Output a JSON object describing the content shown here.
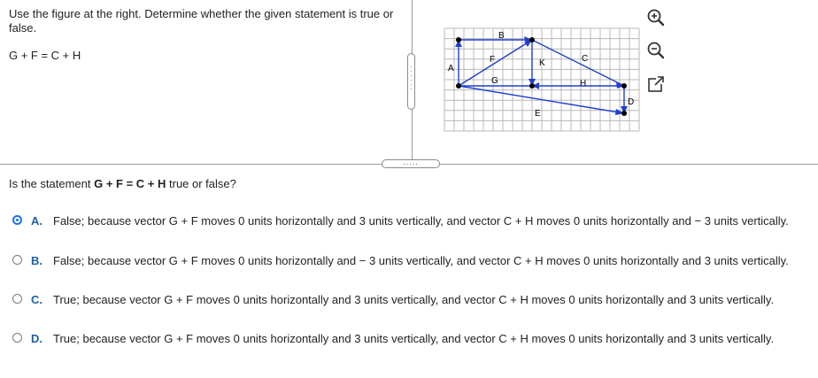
{
  "question_prompt": "Use the figure at the right. Determine whether the given statement is true or false.",
  "statement": "G + F = C + H",
  "figure": {
    "labels": [
      "B",
      "F",
      "K",
      "C",
      "A",
      "G",
      "H",
      "D",
      "E"
    ]
  },
  "tools": [
    "zoom-in-icon",
    "zoom-out-icon",
    "open-new-window-icon"
  ],
  "question": {
    "prefix": "Is the statement ",
    "expr": "G + F = C + H",
    "suffix": " true or false?"
  },
  "options": [
    {
      "letter": "A.",
      "selected": true,
      "text": "False; because vector G + F moves 0 units horizontally and 3 units vertically, and vector C + H moves 0 units horizontally and  − 3 units vertically."
    },
    {
      "letter": "B.",
      "selected": false,
      "text": "False; because vector G + F moves 0 units horizontally and  − 3 units vertically, and vector C + H moves 0 units horizontally and 3 units vertically."
    },
    {
      "letter": "C.",
      "selected": false,
      "text": "True; because vector G + F moves 0 units horizontally and 3 units vertically, and vector C + H moves 0 units horizontally and 3 units vertically."
    },
    {
      "letter": "D.",
      "selected": false,
      "text": "True; because vector G + F moves 0 units horizontally and 3 units vertically, and vector C + H moves 0 units horizontally and 3 units vertically."
    }
  ],
  "colors": {
    "accent": "#1a73e8",
    "vector": "#1f3fcf",
    "letter": "#1f5fa5"
  }
}
